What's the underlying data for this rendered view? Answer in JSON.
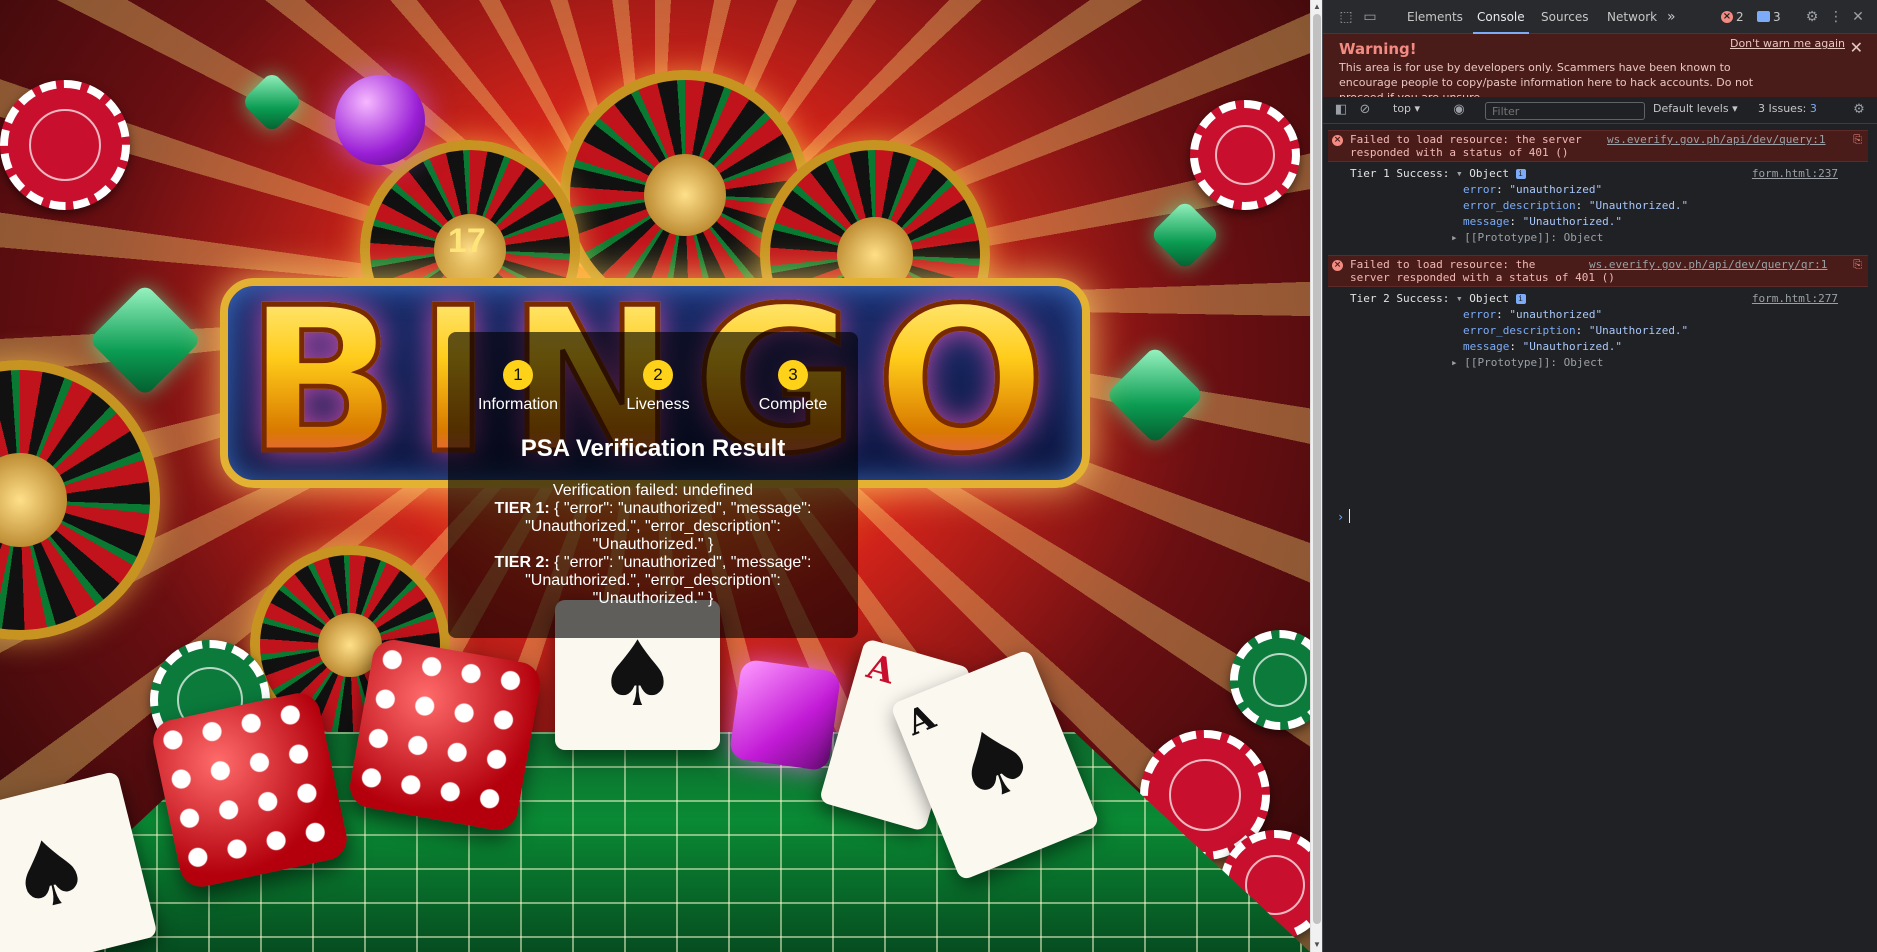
{
  "panel": {
    "steps": [
      {
        "number": "1",
        "label": "Information"
      },
      {
        "number": "2",
        "label": "Liveness"
      },
      {
        "number": "3",
        "label": "Complete"
      }
    ],
    "title": "PSA Verification Result",
    "status": "Verification failed: undefined",
    "tier1_label": "TIER 1:",
    "tier1_text": " { \"error\": \"unauthorized\", \"message\": \"Unauthorized.\", \"error_description\": \"Unauthorized.\" }",
    "tier2_label": "TIER 2:",
    "tier2_text": " { \"error\": \"unauthorized\", \"message\": \"Unauthorized.\", \"error_description\": \"Unauthorized.\" }"
  },
  "background": {
    "banner_text": "BINGO",
    "wheel_number": "17",
    "card_rank": "A",
    "card_suit": "♠"
  },
  "devtools": {
    "tabs": [
      "Elements",
      "Console",
      "Sources",
      "Network"
    ],
    "active_tab": "Console",
    "more_tabs": "»",
    "error_count": "2",
    "message_count": "3",
    "warning": {
      "title": "Warning!",
      "body": "This area is for use by developers only. Scammers have been known to encourage people to copy/paste information here to hack accounts. Do not proceed if you are unsure.",
      "dismiss": "Don't warn me again"
    },
    "toolbar": {
      "context": "top ▾",
      "filter_placeholder": "Filter",
      "levels": "Default levels ▾",
      "issues_label": "3 Issues:",
      "issues_count": "3"
    },
    "console": {
      "err1_line1": "Failed to load resource: the server",
      "err1_line2": "responded with a status of 401 ()",
      "err1_src": "ws.everify.gov.ph/api/dev/query:1",
      "log1_label": "Tier 1 Success:",
      "log1_src": "form.html:237",
      "err2_line1": "Failed to load resource: the",
      "err2_line2": "server responded with a status of 401 ()",
      "err2_src": "ws.everify.gov.ph/api/dev/query/qr:1",
      "log2_label": "Tier 2 Success:",
      "log2_src": "form.html:277",
      "object_label": "Object",
      "fields": [
        {
          "key": "error",
          "value": "\"unauthorized\""
        },
        {
          "key": "error_description",
          "value": "\"Unauthorized.\""
        },
        {
          "key": "message",
          "value": "\"Unauthorized.\""
        }
      ],
      "prototype": "[[Prototype]]: Object",
      "prompt": "›"
    }
  },
  "colors": {
    "accent": "#7cacf8",
    "error_bg": "#4a1c19",
    "step_circle": "#ffd21a"
  }
}
